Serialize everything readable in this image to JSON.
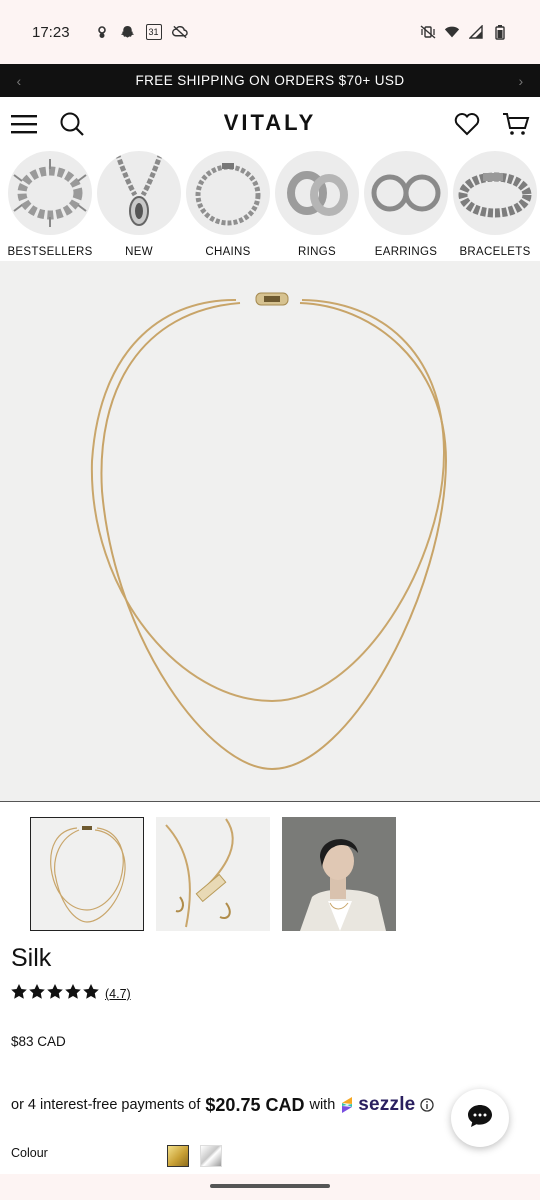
{
  "status_bar": {
    "time": "17:23",
    "left_icons": [
      "podcast-icon",
      "snapchat-icon",
      "calendar-icon",
      "no-cloud-icon"
    ],
    "calendar_day": "31",
    "right_icons": [
      "vibrate-off-icon",
      "wifi-icon",
      "signal-icon",
      "battery-icon"
    ]
  },
  "promo": {
    "text": "FREE SHIPPING ON ORDERS $70+ USD"
  },
  "header": {
    "logo": "VITALY",
    "icons": [
      "menu-icon",
      "search-icon",
      "heart-icon",
      "cart-icon"
    ]
  },
  "categories": [
    {
      "label": "BESTSELLERS"
    },
    {
      "label": "NEW"
    },
    {
      "label": "CHAINS"
    },
    {
      "label": "RINGS"
    },
    {
      "label": "EARRINGS"
    },
    {
      "label": "BRACELETS"
    }
  ],
  "product": {
    "title": "Silk",
    "rating": "(4.7)",
    "stars": 5,
    "price": "$83 CAD",
    "installment_prefix": "or 4 interest-free payments of",
    "installment_amount": "$20.75 CAD",
    "installment_with": "with",
    "installment_brand": "sezzle",
    "colour_label": "Colour",
    "colours": [
      "#d4b040",
      "#d8d8d8"
    ]
  }
}
